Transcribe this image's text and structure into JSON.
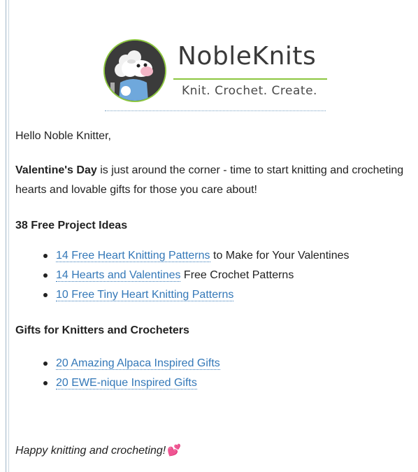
{
  "logo": {
    "brand_name": "NobleKnits",
    "tagline": "Knit. Crochet. Create."
  },
  "email": {
    "greeting": "Hello Noble Knitter,",
    "intro_bold": "Valentine's Day",
    "intro_rest": " is just around the corner - time to start knitting and crocheting hearts and lovable gifts for those you care about!",
    "section1": {
      "heading": "38 Free Project Ideas",
      "items": [
        {
          "link_text": "14 Free Heart Knitting Patterns",
          "after_text": " to Make for Your Valentines"
        },
        {
          "link_text": "14 Hearts and Valentines",
          "after_text": " Free Crochet Patterns"
        },
        {
          "link_text": "10 Free Tiny Heart Knitting Patterns",
          "after_text": ""
        }
      ]
    },
    "section2": {
      "heading": "Gifts for Knitters and Crocheters",
      "items": [
        {
          "link_text": "20 Amazing Alpaca Inspired Gifts",
          "after_text": ""
        },
        {
          "link_text": "20 EWE-nique Inspired Gifts",
          "after_text": ""
        }
      ]
    },
    "closing": "Happy knitting and crocheting!",
    "closing_emoji": "💕"
  },
  "colors": {
    "link": "#3478b8",
    "brand_green": "#8cc63f",
    "text": "#222222"
  }
}
